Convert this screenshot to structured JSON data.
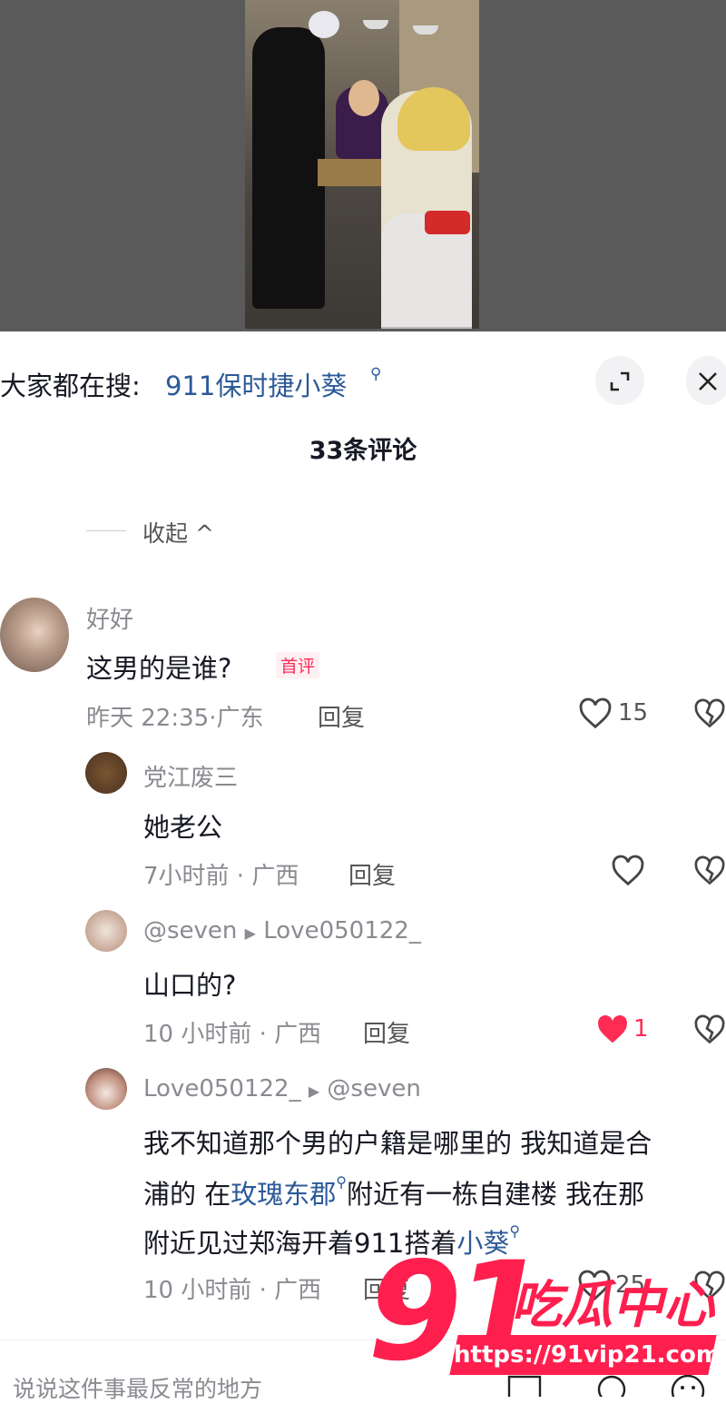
{
  "search": {
    "prefix": "大家都在搜:",
    "query": "911保时捷小葵"
  },
  "comments_count": "33条评论",
  "collapse_label": "收起 ^",
  "comments": [
    {
      "user": "好好",
      "text": "这男的是谁?",
      "tag": "首评",
      "time": "昨天 22:35·广东",
      "reply": "回复",
      "likes": "15"
    },
    {
      "user": "党江废三",
      "text": "她老公",
      "time": "7小时前 · 广西",
      "reply": "回复",
      "likes": ""
    },
    {
      "user": "@seven",
      "reply_to": "Love050122_",
      "text": "山口的?",
      "time": "10 小时前 · 广西",
      "reply": "回复",
      "likes": "1"
    },
    {
      "user": "Love050122_",
      "reply_to": "@seven",
      "text_line1": "我不知道那个男的户籍是哪里的 我知道是合",
      "text_line2_a": "浦的 在",
      "text_line2_link": "玫瑰东郡",
      "text_line2_b": "附近有一栋自建楼 我在那",
      "text_line3_a": "附近见过郑海开着911搭着",
      "text_line3_link": "小葵",
      "time": "10 小时前 · 广西",
      "reply": "回复",
      "likes": "25"
    }
  ],
  "input_placeholder": "说说这件事最反常的地方",
  "watermark": {
    "brand": "91",
    "name": "吃瓜中心",
    "url": "https://91vip21.com"
  },
  "colors": {
    "link": "#2c5a98",
    "accent": "#fe2c55",
    "watermark": "#fe1f4e"
  }
}
